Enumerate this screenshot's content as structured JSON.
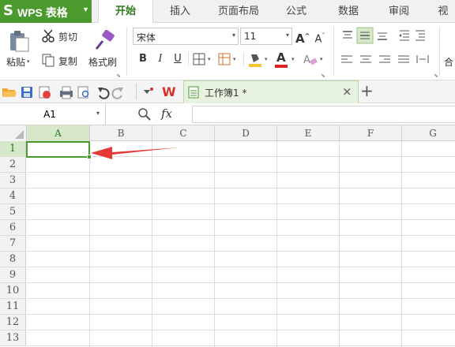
{
  "app": {
    "title": "WPS 表格",
    "logo_glyph": "S",
    "menu_caret": "▼"
  },
  "menu_tabs": [
    {
      "label": "开始",
      "active": true
    },
    {
      "label": "插入"
    },
    {
      "label": "页面布局"
    },
    {
      "label": "公式"
    },
    {
      "label": "数据"
    },
    {
      "label": "审阅"
    },
    {
      "label": "视"
    }
  ],
  "ribbon": {
    "paste_label": "粘贴",
    "cut_label": "剪切",
    "copy_label": "复制",
    "format_painter_label": "格式刷",
    "font_name": "宋体",
    "font_size": "11",
    "bold": "B",
    "italic": "I",
    "underline": "U",
    "font_color_glyph": "A",
    "increase_font_glyph": "A",
    "decrease_font_glyph": "A",
    "merge_label": "合",
    "dropdown_glyph": "▾",
    "accent_color": "#4a9a2e",
    "font_color_bar": "#e02020",
    "fill_color_bar": "#f4c430"
  },
  "quick_access": {
    "doc_tab_label": "工作簿1 *",
    "close_glyph": "×",
    "new_tab_glyph": "+"
  },
  "formula_bar": {
    "name_box": "A1",
    "fx_label": "fx",
    "formula": ""
  },
  "grid": {
    "columns": [
      "A",
      "B",
      "C",
      "D",
      "E",
      "F",
      "G"
    ],
    "rows": [
      "1",
      "2",
      "3",
      "4",
      "5",
      "6",
      "7",
      "8",
      "9",
      "10",
      "11",
      "12",
      "13"
    ],
    "selected_cell": "A1",
    "arrow_color": "#e53935"
  }
}
